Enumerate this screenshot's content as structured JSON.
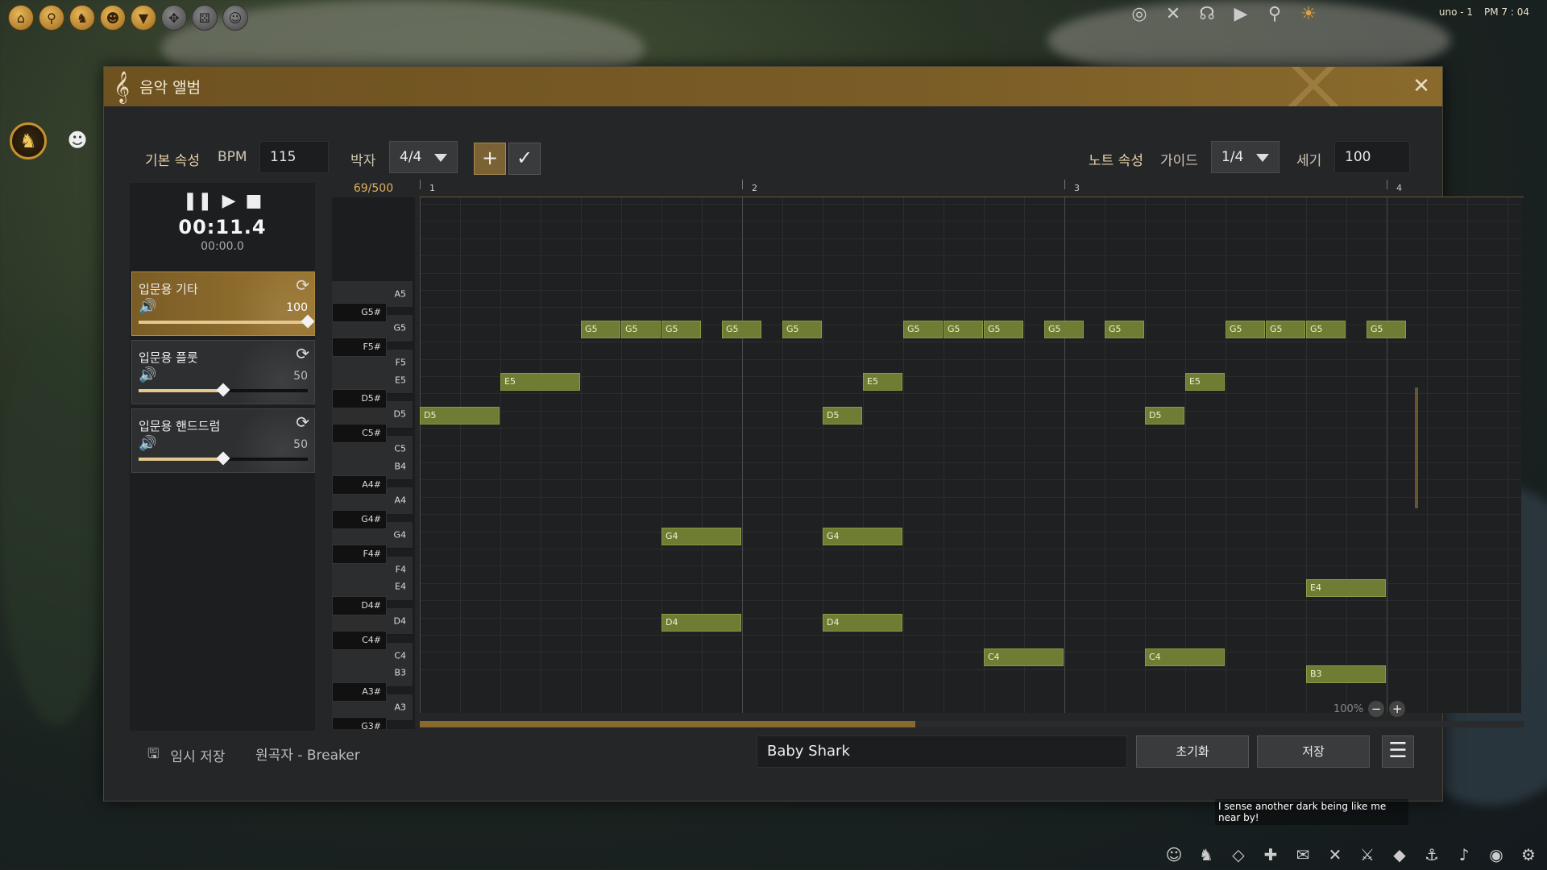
{
  "topbar": {
    "status": "uno - 1",
    "clock": "PM 7 : 04"
  },
  "window": {
    "title": "음악 앨범"
  },
  "toolbar": {
    "basic_props_label": "기본 속성",
    "bpm_label": "BPM",
    "bpm_value": "115",
    "beat_label": "박자",
    "beat_value": "4/4",
    "note_props_label": "노트 속성",
    "guide_label": "가이드",
    "guide_value": "1/4",
    "strength_label": "세기",
    "strength_value": "100"
  },
  "transport": {
    "time_main": "00:11.4",
    "time_sub": "00:00.0"
  },
  "instruments": [
    {
      "name": "입문용 기타",
      "volume": "100",
      "level": 1.0,
      "selected": true
    },
    {
      "name": "입문용 플룻",
      "volume": "50",
      "level": 0.5,
      "selected": false
    },
    {
      "name": "입문용 핸드드럼",
      "volume": "50",
      "level": 0.5,
      "selected": false
    }
  ],
  "counter": "69/500",
  "ruler_marks": [
    "1",
    "2",
    "3",
    "4"
  ],
  "keys": {
    "white": [
      "A5",
      "G5",
      "F5",
      "E5",
      "D5",
      "C5",
      "B4",
      "A4",
      "G4",
      "F4",
      "E4",
      "D4",
      "C4",
      "B3",
      "A3"
    ],
    "black": [
      "G5#",
      "F5#",
      "D5#",
      "C5#",
      "A4#",
      "G4#",
      "F4#",
      "D4#",
      "C4#",
      "A3#",
      "G3#"
    ]
  },
  "notes": [
    {
      "pitch": "G5",
      "start": 4,
      "len": 1
    },
    {
      "pitch": "G5",
      "start": 5,
      "len": 1
    },
    {
      "pitch": "G5",
      "start": 6,
      "len": 1
    },
    {
      "pitch": "G5",
      "start": 7.5,
      "len": 1
    },
    {
      "pitch": "G5",
      "start": 9,
      "len": 1
    },
    {
      "pitch": "G5",
      "start": 12,
      "len": 1
    },
    {
      "pitch": "G5",
      "start": 13,
      "len": 1
    },
    {
      "pitch": "G5",
      "start": 14,
      "len": 1
    },
    {
      "pitch": "G5",
      "start": 15.5,
      "len": 1
    },
    {
      "pitch": "G5",
      "start": 17,
      "len": 1
    },
    {
      "pitch": "G5",
      "start": 20,
      "len": 1
    },
    {
      "pitch": "G5",
      "start": 21,
      "len": 1
    },
    {
      "pitch": "G5",
      "start": 22,
      "len": 1
    },
    {
      "pitch": "G5",
      "start": 23.5,
      "len": 1
    },
    {
      "pitch": "E5",
      "start": 2,
      "len": 2
    },
    {
      "pitch": "E5",
      "start": 11,
      "len": 1
    },
    {
      "pitch": "E5",
      "start": 19,
      "len": 1
    },
    {
      "pitch": "D5",
      "start": 0,
      "len": 2
    },
    {
      "pitch": "D5",
      "start": 10,
      "len": 1
    },
    {
      "pitch": "D5",
      "start": 18,
      "len": 1
    },
    {
      "pitch": "G4",
      "start": 6,
      "len": 2
    },
    {
      "pitch": "G4",
      "start": 10,
      "len": 2
    },
    {
      "pitch": "E4",
      "start": 22,
      "len": 2
    },
    {
      "pitch": "D4",
      "start": 6,
      "len": 2
    },
    {
      "pitch": "D4",
      "start": 10,
      "len": 2
    },
    {
      "pitch": "C4",
      "start": 14,
      "len": 2
    },
    {
      "pitch": "C4",
      "start": 18,
      "len": 2
    },
    {
      "pitch": "B3",
      "start": 22,
      "len": 2
    }
  ],
  "zoom": "100%",
  "bottom": {
    "save_temp": "임시 저장",
    "composer": "원곡자 - Breaker",
    "song_name": "Baby Shark",
    "reset": "초기화",
    "save": "저장"
  },
  "chat": "I sense another dark being like me near by!",
  "colors": {
    "accent": "#7a5c26",
    "note": "#6f7c34"
  }
}
